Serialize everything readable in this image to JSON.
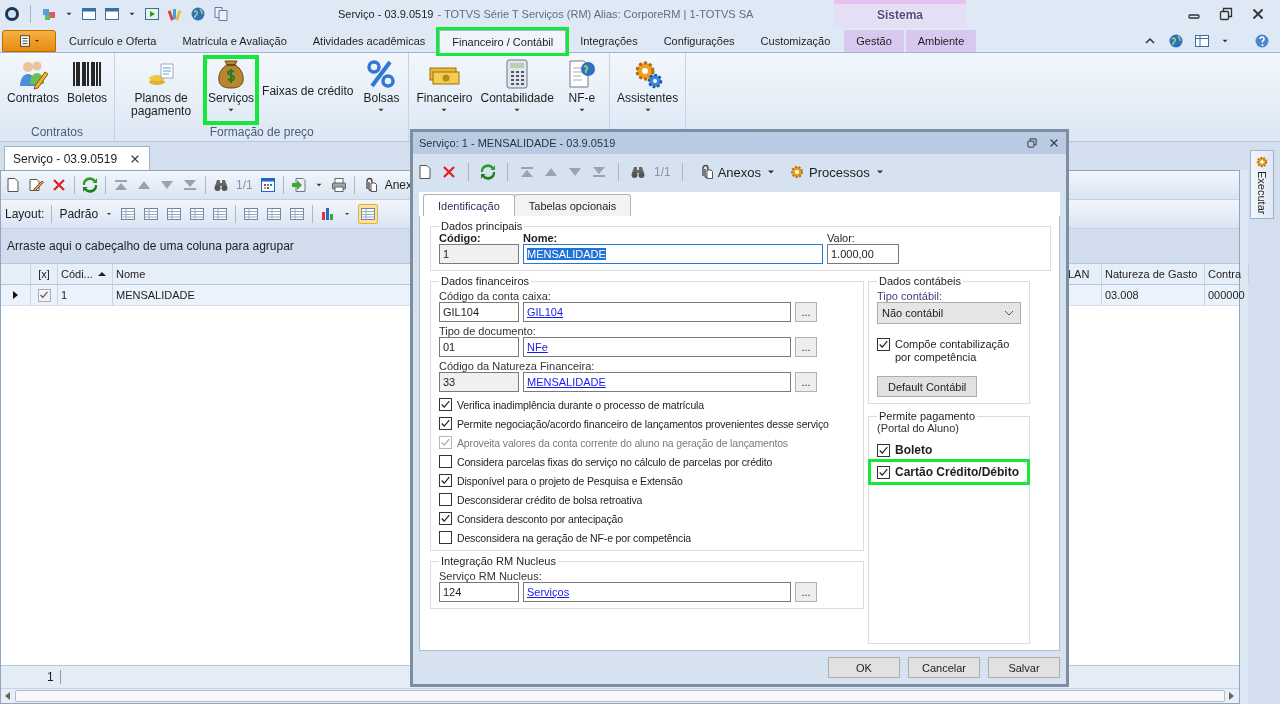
{
  "title_bar": {
    "document": "Serviço - 03.9.0519",
    "application": "- TOTVS Série T Serviços (RM) Alias: CorporeRM | 1-TOTVS SA",
    "context_tab": "Sistema"
  },
  "ribbon": {
    "tabs": [
      {
        "label": "Currículo e Oferta",
        "selected": false,
        "highlighted": false,
        "contextual": false
      },
      {
        "label": "Matrícula e Avaliação",
        "selected": false,
        "highlighted": false,
        "contextual": false
      },
      {
        "label": "Atividades acadêmicas",
        "selected": false,
        "highlighted": false,
        "contextual": false
      },
      {
        "label": "Financeiro / Contábil",
        "selected": true,
        "highlighted": true,
        "contextual": false
      },
      {
        "label": "Integrações",
        "selected": false,
        "highlighted": false,
        "contextual": false
      },
      {
        "label": "Configurações",
        "selected": false,
        "highlighted": false,
        "contextual": false
      },
      {
        "label": "Customização",
        "selected": false,
        "highlighted": false,
        "contextual": false
      },
      {
        "label": "Gestão",
        "selected": false,
        "highlighted": false,
        "contextual": true
      },
      {
        "label": "Ambiente",
        "selected": false,
        "highlighted": false,
        "contextual": true
      }
    ],
    "groups": [
      {
        "label": "Contratos",
        "items": [
          {
            "label": "Contratos",
            "kind": "large",
            "dropdown": false,
            "highlighted": false
          },
          {
            "label": "Boletos",
            "kind": "large",
            "dropdown": false,
            "highlighted": false
          }
        ]
      },
      {
        "label": "Formação de preço",
        "items": [
          {
            "label": "Planos de pagamento",
            "kind": "large",
            "dropdown": false,
            "highlighted": false
          },
          {
            "label": "Serviços",
            "kind": "large",
            "dropdown": true,
            "highlighted": true
          },
          {
            "label": "Faixas de crédito",
            "kind": "text",
            "dropdown": false,
            "highlighted": false
          },
          {
            "label": "Bolsas",
            "kind": "large",
            "dropdown": true,
            "highlighted": false
          }
        ]
      },
      {
        "items": [
          {
            "label": "Financeiro",
            "kind": "large",
            "dropdown": true,
            "highlighted": false
          },
          {
            "label": "Contabilidade",
            "kind": "large",
            "dropdown": true,
            "highlighted": false
          },
          {
            "label": "NF-e",
            "kind": "large",
            "dropdown": true,
            "highlighted": false
          }
        ]
      },
      {
        "items": [
          {
            "label": "Assistentes",
            "kind": "large",
            "dropdown": true,
            "highlighted": false
          }
        ]
      }
    ]
  },
  "document_tab": {
    "label": "Serviço - 03.9.0519"
  },
  "side_panel": {
    "label": "Executar"
  },
  "toolbar": {
    "record_counter": "1/1",
    "attachments": "Anex"
  },
  "layout_bar": {
    "label": "Layout:",
    "layout": "Padrão"
  },
  "group_panel": "Arraste aqui o cabeçalho de uma coluna para agrupar",
  "grid": {
    "columns": [
      {
        "label": "[x]",
        "sorted": false
      },
      {
        "label": "Códi...",
        "sorted": true
      },
      {
        "label": "Nome",
        "sorted": false
      },
      {
        "label": "LAN",
        "sorted": false
      },
      {
        "label": "Natureza de Gasto",
        "sorted": false
      },
      {
        "label": "Contra",
        "sorted": false
      }
    ],
    "rows": [
      {
        "current": true,
        "checked": true,
        "cells": {
          "1": "1",
          "2": "MENSALIDADE",
          "4": "03.008",
          "5": "000000"
        }
      }
    ],
    "footer": "1"
  },
  "dialog": {
    "title": "Serviço: 1 - MENSALIDADE - 03.9.0519",
    "toolbar": {
      "record_counter": "1/1",
      "attachments": "Anexos",
      "processes": "Processos"
    },
    "tabs": [
      {
        "label": "Identificação",
        "selected": true
      },
      {
        "label": "Tabelas opcionais",
        "selected": false
      }
    ],
    "main": {
      "title": "Dados principais",
      "code_label": "Código:",
      "code": "1",
      "name_label": "Nome:",
      "name": "MENSALIDADE",
      "value_label": "Valor:",
      "value": "1.000,00"
    },
    "financial": {
      "title": "Dados financeiros",
      "lookups": [
        {
          "label": "Código da conta caixa:",
          "code": "GIL104",
          "link": "GIL104",
          "readonly": false,
          "browse": "..."
        },
        {
          "label": "Tipo de documento:",
          "code": "01",
          "link": "NFe",
          "readonly": false,
          "browse": "..."
        },
        {
          "label": "Código da Natureza Financeira:",
          "code": "33",
          "link": "MENSALIDADE",
          "readonly": true,
          "browse": "..."
        }
      ],
      "options": [
        {
          "label": "Verifica inadimplência durante o processo de matrícula",
          "checked": true,
          "disabled": false
        },
        {
          "label": "Permite negociação/acordo financeiro de lançamentos provenientes desse serviço",
          "checked": true,
          "disabled": false
        },
        {
          "label": "Aproveita valores da conta corrente do aluno na geração de lançamentos",
          "checked": true,
          "disabled": true
        },
        {
          "label": "Considera parcelas fixas do serviço no cálculo de parcelas por crédito",
          "checked": false,
          "disabled": false
        },
        {
          "label": "Disponível para o projeto de Pesquisa e Extensão",
          "checked": true,
          "disabled": false
        },
        {
          "label": "Desconsiderar crédito de bolsa retroativa",
          "checked": false,
          "disabled": false
        },
        {
          "label": "Considera desconto por antecipação",
          "checked": true,
          "disabled": false
        },
        {
          "label": "Desconsidera na geração de NF-e por competência",
          "checked": false,
          "disabled": false
        }
      ]
    },
    "nucleus": {
      "title": "Integração RM Nucleus",
      "label": "Serviço RM Nucleus:",
      "code": "124",
      "link": "Serviços",
      "browse": "..."
    },
    "accounting": {
      "title": "Dados contábeis",
      "type_label": "Tipo contábil:",
      "type": "Não contábil",
      "compose": {
        "label": "Compõe contabilização por competência",
        "checked": true
      },
      "default_button": "Default Contábil"
    },
    "payment": {
      "title": "Permite pagamento",
      "subtitle": "(Portal do Aluno)",
      "options": [
        {
          "label": "Boleto",
          "checked": true,
          "highlighted": false
        },
        {
          "label": "Cartão Crédito/Débito",
          "checked": true,
          "highlighted": true
        }
      ]
    },
    "buttons": [
      {
        "label": "OK"
      },
      {
        "label": "Cancelar"
      },
      {
        "label": "Salvar"
      }
    ]
  }
}
